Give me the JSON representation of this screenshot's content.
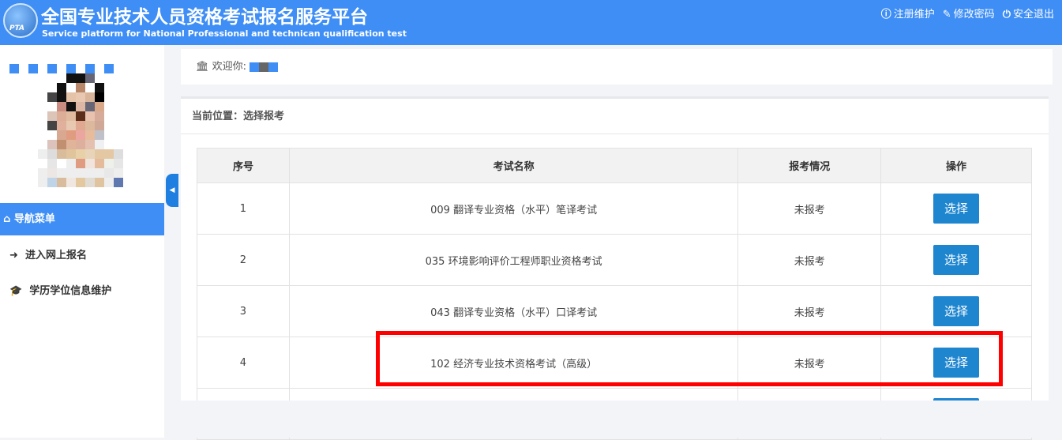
{
  "header": {
    "logo_text": "PTA",
    "title_cn": "全国专业技术人员资格考试报名服务平台",
    "title_en": "Service platform for National Professional and technican qualification test",
    "links": [
      {
        "icon": "info-icon",
        "label": "注册维护"
      },
      {
        "icon": "edit-icon",
        "label": "修改密码"
      },
      {
        "icon": "power-icon",
        "label": "安全退出"
      }
    ]
  },
  "sidebar": {
    "nav_title": "导航菜单",
    "items": [
      {
        "icon": "sign-in-icon",
        "label": "进入网上报名"
      },
      {
        "icon": "graduation-cap-icon",
        "label": "学历学位信息维护"
      }
    ]
  },
  "welcome": {
    "label": "欢迎你:"
  },
  "main": {
    "breadcrumb": "当前位置：选择报考",
    "columns": [
      "序号",
      "考试名称",
      "报考情况",
      "操作"
    ],
    "rows": [
      {
        "no": "1",
        "name": "009 翻译专业资格（水平）笔译考试",
        "status": "未报考",
        "action": "选择"
      },
      {
        "no": "2",
        "name": "035 环境影响评价工程师职业资格考试",
        "status": "未报考",
        "action": "选择"
      },
      {
        "no": "3",
        "name": "043 翻译专业资格（水平）口译考试",
        "status": "未报考",
        "action": "选择"
      },
      {
        "no": "4",
        "name": "102 经济专业技术资格考试（高级）",
        "status": "未报考",
        "action": "选择"
      }
    ]
  },
  "colors": {
    "accent": "#3e8ef5",
    "button": "#1e85cf",
    "highlight": "#ff0000"
  }
}
